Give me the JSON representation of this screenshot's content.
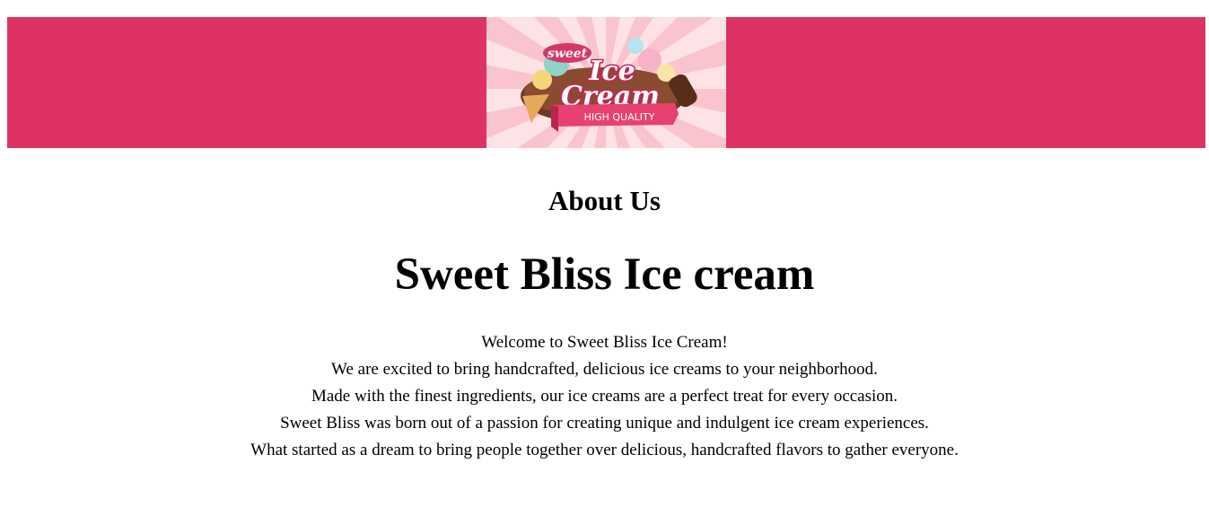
{
  "colors": {
    "banner_bg": "#dd3263",
    "logo_bg_light": "#fde2e6",
    "logo_bg_ray": "#f9c4cc",
    "ribbon": "#e8416f",
    "ribbon_dark": "#b8264f"
  },
  "banner": {
    "logo": {
      "top_word": "sweet",
      "line1": "Ice",
      "line2": "Cream",
      "ribbon_text": "HIGH QUALITY"
    }
  },
  "main": {
    "section_heading": "About Us",
    "brand_heading": "Sweet Bliss Ice cream",
    "paragraph_lines": [
      "Welcome to Sweet Bliss Ice Cream!",
      "We are excited to bring handcrafted, delicious ice creams to your neighborhood.",
      "Made with the finest ingredients, our ice creams are a perfect treat for every occasion.",
      "Sweet Bliss was born out of a passion for creating unique and indulgent ice cream experiences.",
      "What started as a dream to bring people together over delicious, handcrafted flavors to gather everyone."
    ]
  }
}
